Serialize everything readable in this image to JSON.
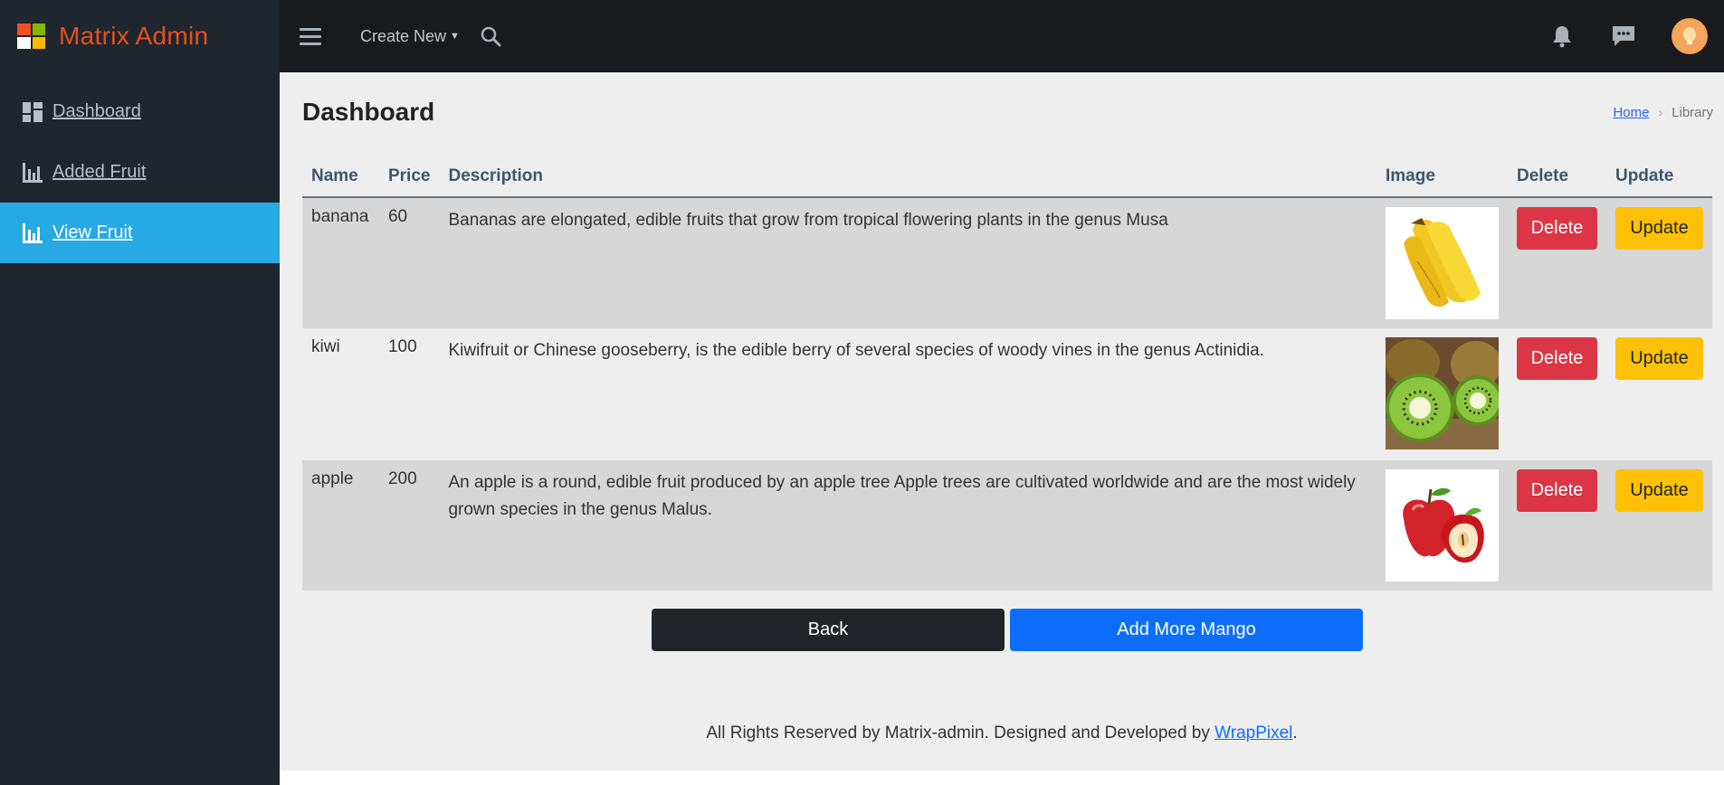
{
  "brand": {
    "name": "Matrix Admin"
  },
  "sidebar": {
    "items": [
      {
        "label": "Dashboard",
        "icon": "dashboard-icon",
        "active": false
      },
      {
        "label": "Added Fruit",
        "icon": "bar-chart-icon",
        "active": false
      },
      {
        "label": "View Fruit",
        "icon": "bar-chart-icon",
        "active": true
      }
    ]
  },
  "topbar": {
    "create_new": "Create New",
    "icons": [
      "menu-icon",
      "search-icon",
      "bell-icon",
      "chat-icon",
      "avatar"
    ]
  },
  "page": {
    "title": "Dashboard",
    "breadcrumb": {
      "home": "Home",
      "current": "Library"
    }
  },
  "table": {
    "headers": {
      "name": "Name",
      "price": "Price",
      "description": "Description",
      "image": "Image",
      "delete": "Delete",
      "update": "Update"
    },
    "rows": [
      {
        "name": "banana",
        "price": "60",
        "description": "Bananas are elongated, edible fruits that grow from tropical flowering plants in the genus Musa",
        "image": "banana",
        "delete": "Delete",
        "update": "Update"
      },
      {
        "name": "kiwi",
        "price": "100",
        "description": "Kiwifruit or Chinese gooseberry, is the edible berry of several species of woody vines in the genus Actinidia.",
        "image": "kiwi",
        "delete": "Delete",
        "update": "Update"
      },
      {
        "name": "apple",
        "price": "200",
        "description": "An apple is a round, edible fruit produced by an apple tree Apple trees are cultivated worldwide and are the most widely grown species in the genus Malus.",
        "image": "apple",
        "delete": "Delete",
        "update": "Update"
      }
    ]
  },
  "actions": {
    "back": "Back",
    "add_more": "Add More Mango"
  },
  "footer": {
    "text": "All Rights Reserved by Matrix-admin. Designed and Developed by ",
    "link": "WrapPixel",
    "suffix": "."
  },
  "colors": {
    "sidebar_bg": "#1f262d",
    "active_nav": "#27a9e3",
    "brand": "#e8501f",
    "delete": "#dc3545",
    "update": "#ffc107",
    "primary": "#0d6efd"
  }
}
